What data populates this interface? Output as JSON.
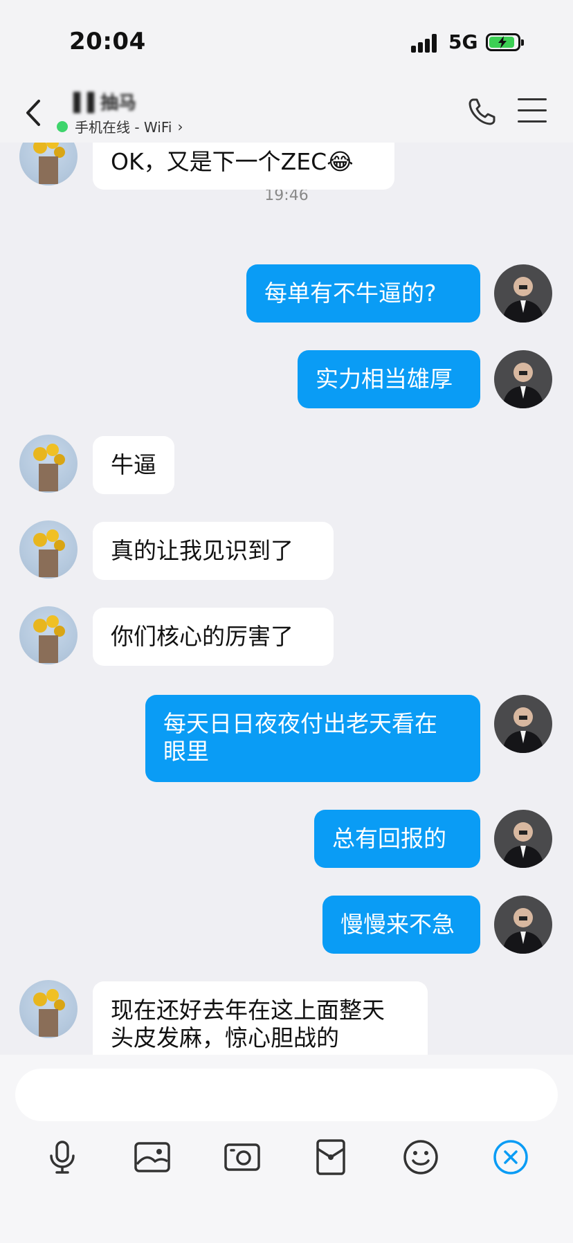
{
  "status_bar": {
    "time": "20:04",
    "network": "5G"
  },
  "header": {
    "contact_name": "▐▐ 抽马",
    "presence": "手机在线 - WiFi",
    "presence_chevron": "›"
  },
  "timestamp": "19:46",
  "messages": [
    {
      "side": "in",
      "text": "OK，又是下一个ZEC😂"
    },
    {
      "side": "out",
      "text": "每单有不牛逼的?"
    },
    {
      "side": "out",
      "text": "实力相当雄厚"
    },
    {
      "side": "in",
      "text": "牛逼"
    },
    {
      "side": "in",
      "text": "真的让我见识到了"
    },
    {
      "side": "in",
      "text": "你们核心的厉害了"
    },
    {
      "side": "out",
      "text": "每天日日夜夜付出老天看在\n眼里"
    },
    {
      "side": "out",
      "text": "总有回报的"
    },
    {
      "side": "out",
      "text": "慢慢来不急"
    },
    {
      "side": "in",
      "text": "现在还好去年在这上面整天\n头皮发麻，惊心胆战的"
    }
  ],
  "input": {
    "value": "",
    "placeholder": ""
  },
  "toolbar": [
    "microphone-icon",
    "image-icon",
    "camera-icon",
    "red-packet-icon",
    "emoji-icon",
    "close-circle-icon"
  ],
  "colors": {
    "outgoing_bubble": "#0a9cf5",
    "incoming_bubble": "#ffffff",
    "background": "#efeff3",
    "accent": "#0a9cf5"
  }
}
